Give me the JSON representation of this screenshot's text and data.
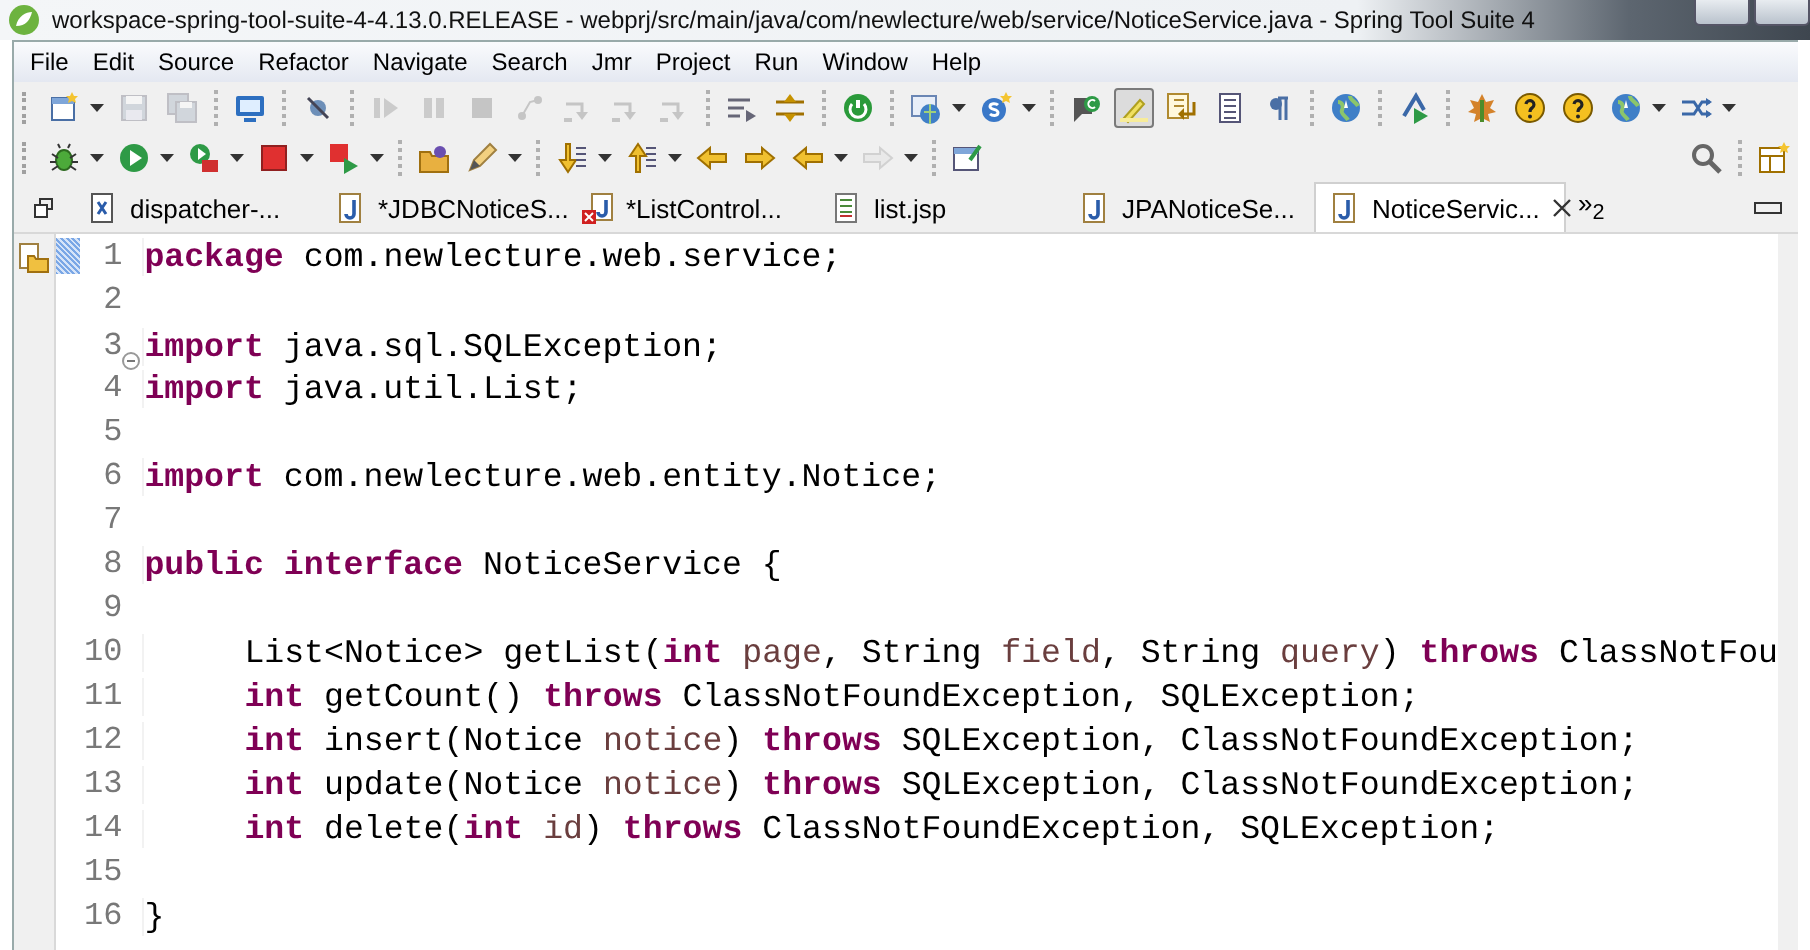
{
  "window": {
    "title": "workspace-spring-tool-suite-4-4.13.0.RELEASE - webprj/src/main/java/com/newlecture/web/service/NoticeService.java - Spring Tool Suite 4"
  },
  "menu": [
    "File",
    "Edit",
    "Source",
    "Refactor",
    "Navigate",
    "Search",
    "Jmr",
    "Project",
    "Run",
    "Window",
    "Help"
  ],
  "toolbar_rows": [
    {
      "items": [
        {
          "kind": "button",
          "dropdown": true,
          "disabled": false,
          "pressed": false
        },
        {
          "kind": "button",
          "dropdown": false,
          "disabled": true,
          "pressed": false
        },
        {
          "kind": "button",
          "dropdown": false,
          "disabled": true,
          "pressed": false
        },
        {
          "kind": "separator"
        },
        {
          "kind": "button",
          "dropdown": false,
          "disabled": false,
          "pressed": false
        },
        {
          "kind": "separator"
        },
        {
          "kind": "button",
          "dropdown": false,
          "disabled": false,
          "pressed": false
        },
        {
          "kind": "separator"
        },
        {
          "kind": "button",
          "dropdown": false,
          "disabled": true,
          "pressed": false
        },
        {
          "kind": "button",
          "dropdown": false,
          "disabled": true,
          "pressed": false
        },
        {
          "kind": "button",
          "dropdown": false,
          "disabled": true,
          "pressed": false
        },
        {
          "kind": "button",
          "dropdown": false,
          "disabled": true,
          "pressed": false
        },
        {
          "kind": "button",
          "dropdown": false,
          "disabled": true,
          "pressed": false
        },
        {
          "kind": "button",
          "dropdown": false,
          "disabled": true,
          "pressed": false
        },
        {
          "kind": "button",
          "dropdown": false,
          "disabled": true,
          "pressed": false
        },
        {
          "kind": "separator"
        },
        {
          "kind": "button",
          "dropdown": false,
          "disabled": false,
          "pressed": false
        },
        {
          "kind": "button",
          "dropdown": false,
          "disabled": false,
          "pressed": false
        },
        {
          "kind": "separator"
        },
        {
          "kind": "button",
          "dropdown": false,
          "disabled": false,
          "pressed": false
        },
        {
          "kind": "separator"
        },
        {
          "kind": "button",
          "dropdown": true,
          "disabled": false,
          "pressed": false
        },
        {
          "kind": "button",
          "dropdown": true,
          "disabled": false,
          "pressed": false
        },
        {
          "kind": "separator"
        },
        {
          "kind": "button",
          "dropdown": false,
          "disabled": false,
          "pressed": false
        },
        {
          "kind": "button",
          "dropdown": false,
          "disabled": false,
          "pressed": true
        },
        {
          "kind": "button",
          "dropdown": false,
          "disabled": false,
          "pressed": false
        },
        {
          "kind": "button",
          "dropdown": false,
          "disabled": false,
          "pressed": false
        },
        {
          "kind": "button",
          "dropdown": false,
          "disabled": false,
          "pressed": false
        },
        {
          "kind": "separator"
        },
        {
          "kind": "button",
          "dropdown": false,
          "disabled": false,
          "pressed": false
        },
        {
          "kind": "separator"
        },
        {
          "kind": "button",
          "dropdown": false,
          "disabled": false,
          "pressed": false
        },
        {
          "kind": "separator"
        },
        {
          "kind": "button",
          "dropdown": false,
          "disabled": false,
          "pressed": false
        },
        {
          "kind": "button",
          "dropdown": false,
          "disabled": false,
          "pressed": false
        },
        {
          "kind": "button",
          "dropdown": false,
          "disabled": false,
          "pressed": false
        },
        {
          "kind": "button",
          "dropdown": true,
          "disabled": false,
          "pressed": false
        },
        {
          "kind": "button",
          "dropdown": true,
          "disabled": false,
          "pressed": false
        }
      ]
    },
    {
      "items": [
        {
          "kind": "button",
          "dropdown": true,
          "disabled": false,
          "pressed": false
        },
        {
          "kind": "button",
          "dropdown": true,
          "disabled": false,
          "pressed": false
        },
        {
          "kind": "button",
          "dropdown": true,
          "disabled": false,
          "pressed": false
        },
        {
          "kind": "button",
          "dropdown": true,
          "disabled": false,
          "pressed": false
        },
        {
          "kind": "button",
          "dropdown": true,
          "disabled": false,
          "pressed": false
        },
        {
          "kind": "separator"
        },
        {
          "kind": "button",
          "dropdown": false,
          "disabled": false,
          "pressed": false
        },
        {
          "kind": "button",
          "dropdown": true,
          "disabled": false,
          "pressed": false
        },
        {
          "kind": "separator"
        },
        {
          "kind": "button",
          "dropdown": true,
          "disabled": false,
          "pressed": false
        },
        {
          "kind": "button",
          "dropdown": true,
          "disabled": false,
          "pressed": false
        },
        {
          "kind": "button",
          "dropdown": false,
          "disabled": false,
          "pressed": false
        },
        {
          "kind": "button",
          "dropdown": false,
          "disabled": false,
          "pressed": false
        },
        {
          "kind": "button",
          "dropdown": true,
          "disabled": false,
          "pressed": false
        },
        {
          "kind": "button",
          "dropdown": true,
          "disabled": true,
          "pressed": false
        },
        {
          "kind": "separator"
        },
        {
          "kind": "button",
          "dropdown": false,
          "disabled": false,
          "pressed": false
        },
        {
          "kind": "spacer"
        },
        {
          "kind": "button",
          "dropdown": false,
          "disabled": false,
          "pressed": false
        },
        {
          "kind": "separator"
        },
        {
          "kind": "button",
          "dropdown": false,
          "disabled": false,
          "pressed": false
        }
      ]
    }
  ],
  "editor_tabs": [
    {
      "kind": "xml",
      "label": "dispatcher-...",
      "selected": false
    },
    {
      "kind": "java",
      "label": "*JDBCNoticeS...",
      "selected": false
    },
    {
      "kind": "java-error",
      "label": "*ListControl...",
      "selected": false
    },
    {
      "kind": "jsp",
      "label": "list.jsp",
      "selected": false
    },
    {
      "kind": "java",
      "label": "JPANoticeSe...",
      "selected": false
    },
    {
      "kind": "java",
      "label": "NoticeServic...",
      "selected": true
    }
  ],
  "tab_overflow": "»$_{2}$",
  "code_lines": [
    {
      "number": "1",
      "indented": false,
      "tokens": [
        {
          "kind": "keyword",
          "text": "package"
        },
        {
          "kind": "plain",
          "text": " com.newlecture.web.service;"
        }
      ]
    },
    {
      "number": "2"
    },
    {
      "number": "3",
      "fold": {
        "expanded": true
      },
      "indented": false,
      "tokens": [
        {
          "kind": "keyword",
          "text": "import"
        },
        {
          "kind": "plain",
          "text": " java.sql.SQLException;"
        }
      ]
    },
    {
      "number": "4",
      "indented": false,
      "tokens": [
        {
          "kind": "keyword",
          "text": "import"
        },
        {
          "kind": "plain",
          "text": " java.util.List;"
        }
      ]
    },
    {
      "number": "5"
    },
    {
      "number": "6",
      "indented": false,
      "tokens": [
        {
          "kind": "keyword",
          "text": "import"
        },
        {
          "kind": "plain",
          "text": " com.newlecture.web.entity.Notice;"
        }
      ]
    },
    {
      "number": "7"
    },
    {
      "number": "8",
      "indented": false,
      "tokens": [
        {
          "kind": "keyword",
          "text": "public"
        },
        {
          "kind": "keyword",
          "text": " interface"
        },
        {
          "kind": "plain",
          "text": " NoticeService {"
        }
      ]
    },
    {
      "number": "9"
    },
    {
      "number": "10",
      "indented": true,
      "tokens": [
        {
          "kind": "plain",
          "text": "List<Notice> getList("
        },
        {
          "kind": "keyword",
          "text": "int"
        },
        {
          "kind": "param",
          "text": " page"
        },
        {
          "kind": "plain",
          "text": ", String "
        },
        {
          "kind": "param",
          "text": "field"
        },
        {
          "kind": "plain",
          "text": ", String "
        },
        {
          "kind": "param",
          "text": "query"
        },
        {
          "kind": "plain",
          "text": ") "
        },
        {
          "kind": "keyword",
          "text": "throws"
        },
        {
          "kind": "plain",
          "text": " ClassNotFou"
        }
      ]
    },
    {
      "number": "11",
      "indented": true,
      "tokens": [
        {
          "kind": "keyword",
          "text": "int"
        },
        {
          "kind": "plain",
          "text": " getCount() "
        },
        {
          "kind": "keyword",
          "text": "throws"
        },
        {
          "kind": "plain",
          "text": " ClassNotFoundException, SQLException;"
        }
      ]
    },
    {
      "number": "12",
      "indented": true,
      "tokens": [
        {
          "kind": "keyword",
          "text": "int"
        },
        {
          "kind": "plain",
          "text": " insert(Notice "
        },
        {
          "kind": "param",
          "text": "notice"
        },
        {
          "kind": "plain",
          "text": ") "
        },
        {
          "kind": "keyword",
          "text": "throws"
        },
        {
          "kind": "plain",
          "text": " SQLException, ClassNotFoundException;"
        }
      ]
    },
    {
      "number": "13",
      "indented": true,
      "tokens": [
        {
          "kind": "keyword",
          "text": "int"
        },
        {
          "kind": "plain",
          "text": " update(Notice "
        },
        {
          "kind": "param",
          "text": "notice"
        },
        {
          "kind": "plain",
          "text": ") "
        },
        {
          "kind": "keyword",
          "text": "throws"
        },
        {
          "kind": "plain",
          "text": " SQLException, ClassNotFoundException;"
        }
      ]
    },
    {
      "number": "14",
      "indented": true,
      "tokens": [
        {
          "kind": "keyword",
          "text": "int"
        },
        {
          "kind": "plain",
          "text": " delete("
        },
        {
          "kind": "keyword",
          "text": "int"
        },
        {
          "kind": "param",
          "text": " id"
        },
        {
          "kind": "plain",
          "text": ") "
        },
        {
          "kind": "keyword",
          "text": "throws"
        },
        {
          "kind": "plain",
          "text": " ClassNotFoundException, SQLException;"
        }
      ]
    },
    {
      "number": "15"
    },
    {
      "number": "16",
      "indented": false,
      "tokens": [
        {
          "kind": "plain",
          "text": "}"
        }
      ]
    }
  ]
}
